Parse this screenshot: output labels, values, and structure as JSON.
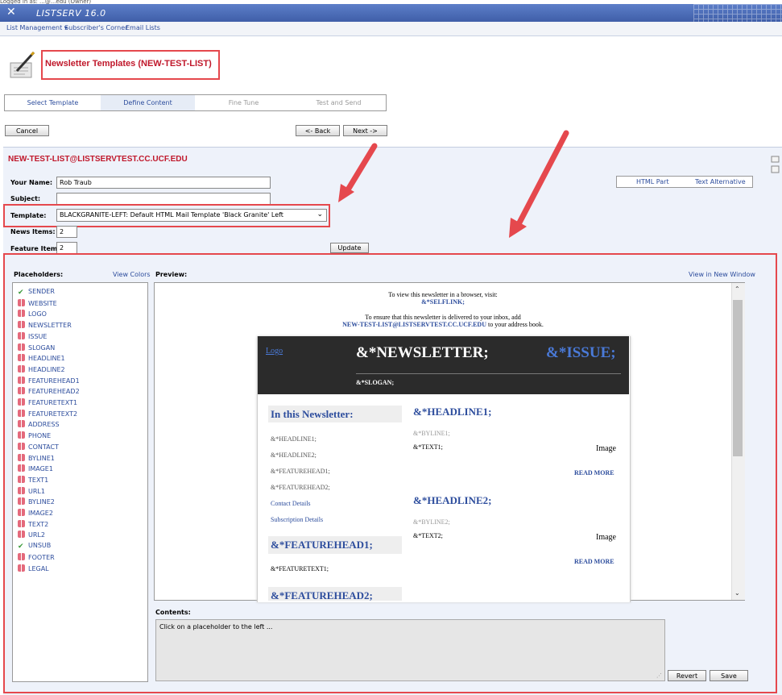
{
  "window": {
    "top_strip": "Logged in as: ...@...edu (Owner)",
    "app_title": "LISTSERV 16.0"
  },
  "menu": {
    "items": [
      "List Management ▾",
      "Subscriber's Corner",
      "Email Lists"
    ]
  },
  "page": {
    "title": "Newsletter Templates (NEW-TEST-LIST)"
  },
  "wizard": {
    "steps": [
      "Select Template",
      "Define Content",
      "Fine Tune",
      "Test and Send"
    ],
    "active_index": 1
  },
  "nav_buttons": {
    "cancel": "Cancel",
    "back": "<- Back",
    "next": "Next ->"
  },
  "form": {
    "list_address": "NEW-TEST-LIST@LISTSERVTEST.CC.UCF.EDU",
    "your_name_label": "Your Name:",
    "your_name_value": "Rob     Traub",
    "subject_label": "Subject:",
    "subject_value": "",
    "template_label": "Template:",
    "template_value": "BLACKGRANITE-LEFT:  Default HTML Mail Template 'Black Granite' Left",
    "news_items_label": "News Items:",
    "news_items_value": "2",
    "feature_items_label": "Feature Items:",
    "feature_items_value": "2",
    "update_button": "Update",
    "part_html": "HTML Part",
    "part_text": "Text Alternative"
  },
  "placeholders": {
    "label": "Placeholders:",
    "view_colors": "View Colors",
    "items": [
      {
        "name": "SENDER",
        "icon": "check"
      },
      {
        "name": "WEBSITE",
        "icon": "gift"
      },
      {
        "name": "LOGO",
        "icon": "gift"
      },
      {
        "name": "NEWSLETTER",
        "icon": "gift"
      },
      {
        "name": "ISSUE",
        "icon": "gift"
      },
      {
        "name": "SLOGAN",
        "icon": "gift"
      },
      {
        "name": "HEADLINE1",
        "icon": "gift"
      },
      {
        "name": "HEADLINE2",
        "icon": "gift"
      },
      {
        "name": "FEATUREHEAD1",
        "icon": "gift"
      },
      {
        "name": "FEATUREHEAD2",
        "icon": "gift"
      },
      {
        "name": "FEATURETEXT1",
        "icon": "gift"
      },
      {
        "name": "FEATURETEXT2",
        "icon": "gift"
      },
      {
        "name": "ADDRESS",
        "icon": "gift"
      },
      {
        "name": "PHONE",
        "icon": "gift"
      },
      {
        "name": "CONTACT",
        "icon": "gift"
      },
      {
        "name": "BYLINE1",
        "icon": "gift"
      },
      {
        "name": "IMAGE1",
        "icon": "gift"
      },
      {
        "name": "TEXT1",
        "icon": "gift"
      },
      {
        "name": "URL1",
        "icon": "gift"
      },
      {
        "name": "BYLINE2",
        "icon": "gift"
      },
      {
        "name": "IMAGE2",
        "icon": "gift"
      },
      {
        "name": "TEXT2",
        "icon": "gift"
      },
      {
        "name": "URL2",
        "icon": "gift"
      },
      {
        "name": "UNSUB",
        "icon": "check"
      },
      {
        "name": "FOOTER",
        "icon": "gift"
      },
      {
        "name": "LEGAL",
        "icon": "gift"
      }
    ]
  },
  "preview": {
    "label": "Preview:",
    "view_new_window": "View in New Window",
    "browser_line": "To view this newsletter in a browser, visit:",
    "selflink": "&*SELFLINK;",
    "inbox_line": "To ensure that this newsletter is delivered to your inbox, add",
    "address": "NEW-TEST-LIST@LISTSERVTEST.CC.UCF.EDU",
    "address_suffix": " to your address book.",
    "logo": "Logo",
    "newsletter": "&*NEWSLETTER;",
    "issue": "&*ISSUE;",
    "slogan": "&*SLOGAN;",
    "in_this": "In this Newsletter:",
    "toc": [
      "&*HEADLINE1;",
      "&*HEADLINE2;",
      "&*FEATUREHEAD1;",
      "&*FEATUREHEAD2;",
      "Contact Details",
      "Subscription Details"
    ],
    "featurehead1": "&*FEATUREHEAD1;",
    "featuretext1": "&*FEATURETEXT1;",
    "featurehead2": "&*FEATUREHEAD2;",
    "headline1": "&*HEADLINE1;",
    "byline1": "&*BYLINE1;",
    "text1": "&*TEXT1;",
    "image1": "Image",
    "read_more1": "READ MORE",
    "headline2": "&*HEADLINE2;",
    "byline2": "&*BYLINE2;",
    "text2": "&*TEXT2;",
    "image2": "Image",
    "read_more2": "READ MORE"
  },
  "contents": {
    "label": "Contents:",
    "value": "Click on a placeholder to the left ...",
    "revert": "Revert",
    "save": "Save"
  },
  "colors": {
    "accent_red": "#c0182b",
    "link_blue": "#2d4d9d",
    "highlight_red": "#e5484d",
    "header_dark": "#2b2b2b"
  }
}
